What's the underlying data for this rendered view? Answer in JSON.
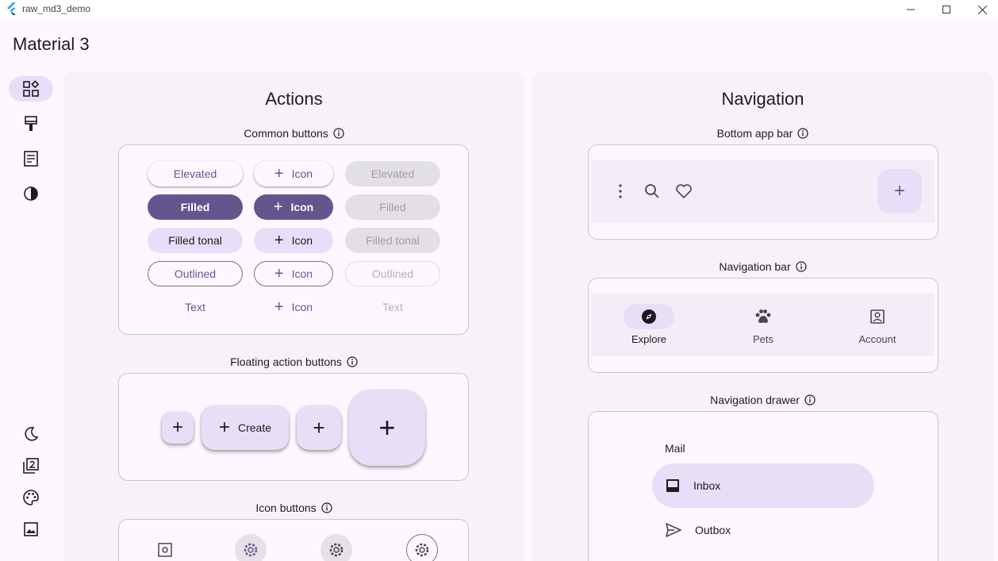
{
  "window": {
    "title": "raw_md3_demo"
  },
  "app": {
    "title": "Material 3"
  },
  "rail": [
    "component-icon",
    "format-paint-icon",
    "article-icon",
    "contrast-icon"
  ],
  "actions": {
    "title": "Actions",
    "common_buttons": {
      "title": "Common buttons",
      "rows": [
        [
          "Elevated",
          "Icon",
          "Elevated"
        ],
        [
          "Filled",
          "Icon",
          "Filled"
        ],
        [
          "Filled tonal",
          "Icon",
          "Filled tonal"
        ],
        [
          "Outlined",
          "Icon",
          "Outlined"
        ],
        [
          "Text",
          "Icon",
          "Text"
        ]
      ]
    },
    "fab": {
      "title": "Floating action buttons",
      "extended_label": "Create"
    },
    "icon_buttons": {
      "title": "Icon buttons"
    }
  },
  "navigation": {
    "title": "Navigation",
    "bottom_app_bar": {
      "title": "Bottom app bar"
    },
    "navigation_bar": {
      "title": "Navigation bar",
      "destinations": [
        "Explore",
        "Pets",
        "Account"
      ],
      "selected": "Explore"
    },
    "navigation_drawer": {
      "title": "Navigation drawer",
      "header": "Mail",
      "items": [
        "Inbox",
        "Outbox"
      ],
      "selected": "Inbox"
    }
  },
  "colors": {
    "primary": "#65558f",
    "secondary_container": "#e8def8",
    "surface": "#fef7ff"
  }
}
